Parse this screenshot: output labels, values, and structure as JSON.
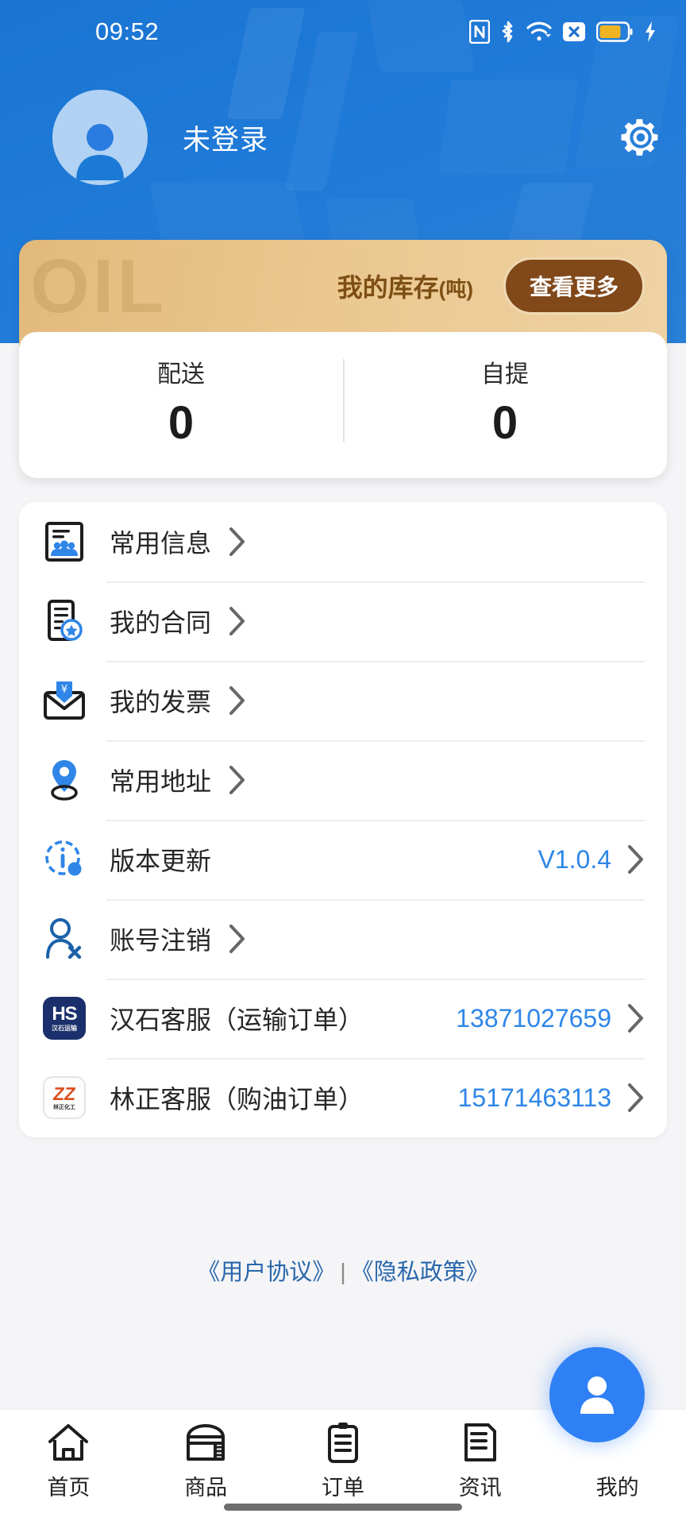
{
  "status_bar": {
    "time": "09:52",
    "icons": [
      "nfc-icon",
      "bluetooth-icon",
      "wifi-icon",
      "no-sim-icon",
      "battery-icon",
      "charging-bolt-icon"
    ]
  },
  "header": {
    "user_name": "未登录",
    "avatar_icon": "person-icon",
    "settings_icon": "gear-icon",
    "background_color": "#1974d2"
  },
  "inventory_card": {
    "watermark": "OIL",
    "title": "我的库存",
    "unit": "(吨)",
    "more_button": "查看更多",
    "stats": [
      {
        "label": "配送",
        "value": "0"
      },
      {
        "label": "自提",
        "value": "0"
      }
    ],
    "accent_color": "#e9c68d",
    "button_color": "#81481a"
  },
  "menu": {
    "items": [
      {
        "label": "常用信息",
        "value": "",
        "icon": "contacts-card-icon"
      },
      {
        "label": "我的合同",
        "value": "",
        "icon": "contract-star-icon"
      },
      {
        "label": "我的发票",
        "value": "",
        "icon": "invoice-envelope-icon"
      },
      {
        "label": "常用地址",
        "value": "",
        "icon": "location-pin-icon"
      },
      {
        "label": "版本更新",
        "value": "V1.0.4",
        "icon": "info-update-icon"
      },
      {
        "label": "账号注销",
        "value": "",
        "icon": "user-delete-icon"
      },
      {
        "label": "汉石客服（运输订单）",
        "value": "13871027659",
        "icon": "hanshi-brand-icon"
      },
      {
        "label": "林正客服（购油订单）",
        "value": "15171463113",
        "icon": "linzheng-brand-icon"
      }
    ],
    "chevron_icon": "chevron-right-icon",
    "value_color": "#2f86e8"
  },
  "legal": {
    "user_agreement": "《用户协议》",
    "separator": "|",
    "privacy_policy": "《隐私政策》",
    "link_color": "#2a67ab"
  },
  "tabbar": {
    "items": [
      {
        "label": "首页",
        "icon": "home-icon",
        "active": false
      },
      {
        "label": "商品",
        "icon": "tank-icon",
        "active": false
      },
      {
        "label": "订单",
        "icon": "clipboard-icon",
        "active": false
      },
      {
        "label": "资讯",
        "icon": "news-icon",
        "active": false
      },
      {
        "label": "我的",
        "icon": "person-icon",
        "active": true
      }
    ],
    "active_color": "#2f80f5"
  },
  "brand_icons": {
    "hanshi": {
      "mark": "HS",
      "caption": "汉石运输"
    },
    "linzheng": {
      "mark": "ZZ",
      "caption": "林正化工"
    }
  }
}
